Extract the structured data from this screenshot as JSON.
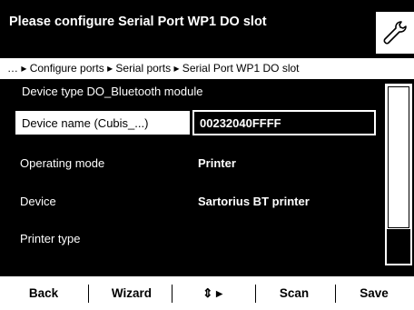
{
  "header": {
    "title": "Please configure Serial Port WP1 DO slot",
    "settings_icon": "wrench-icon"
  },
  "breadcrumb": {
    "text": "… ▸ Configure ports ▸ Serial ports ▸ Serial Port WP1 DO slot"
  },
  "form": {
    "header_row": "Device type DO_Bluetooth module",
    "device_name_label": "Device name (Cubis_...)",
    "device_name_value": "00232040FFFF",
    "operating_mode_label": "Operating mode",
    "operating_mode_value": "Printer",
    "device_label": "Device",
    "device_value": "Sartorius BT printer",
    "printer_type_label": "Printer type"
  },
  "toolbar": {
    "back_label": "Back",
    "wizard_label": "Wizard",
    "nav_label": "⇕ ▸",
    "scan_label": "Scan",
    "save_label": "Save"
  },
  "colors": {
    "background": "#000000",
    "foreground": "#ffffff"
  }
}
